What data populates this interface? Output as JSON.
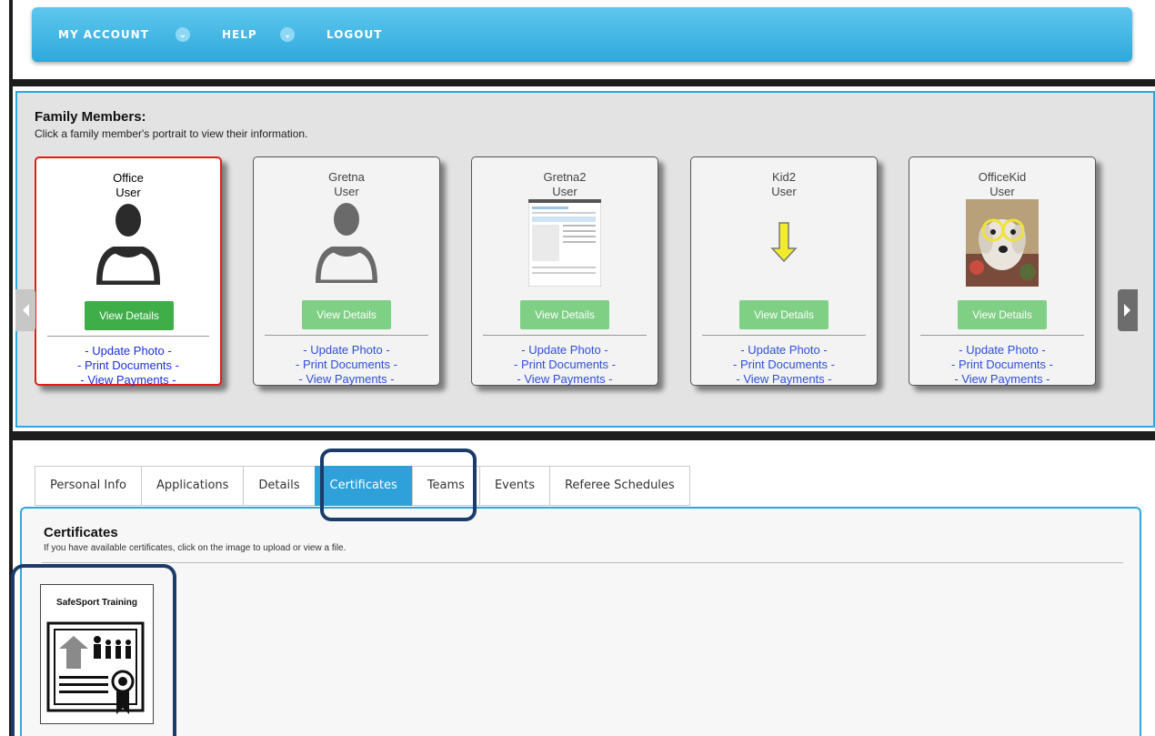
{
  "topnav": {
    "items": [
      {
        "label": "MY ACCOUNT",
        "has_dropdown": true
      },
      {
        "label": "HELP",
        "has_dropdown": true
      },
      {
        "label": "LOGOUT",
        "has_dropdown": false
      }
    ],
    "dropdown_glyph": "⌄"
  },
  "family": {
    "title": "Family Members:",
    "subtitle": "Click a family member's portrait to view their information.",
    "members": [
      {
        "first": "Office",
        "last": "User",
        "photo": "silhouette-icon",
        "active": true
      },
      {
        "first": "Gretna",
        "last": "User",
        "photo": "silhouette-outline-icon",
        "active": false
      },
      {
        "first": "Gretna2",
        "last": "User",
        "photo": "screenshot-thumbnail",
        "active": false
      },
      {
        "first": "Kid2",
        "last": "User",
        "photo": "down-arrow-icon",
        "active": false
      },
      {
        "first": "OfficeKid",
        "last": "User",
        "photo": "dog-photo",
        "active": false
      }
    ],
    "view_details": "View Details",
    "link_update_photo": "- Update Photo -",
    "link_print_documents": "- Print Documents -",
    "link_view_payments": "- View Payments -"
  },
  "tabs": [
    {
      "label": "Personal Info",
      "active": false
    },
    {
      "label": "Applications",
      "active": false
    },
    {
      "label": "Details",
      "active": false
    },
    {
      "label": "Certificates",
      "active": true
    },
    {
      "label": "Teams",
      "active": false
    },
    {
      "label": "Events",
      "active": false
    },
    {
      "label": "Referee Schedules",
      "active": false
    }
  ],
  "certificates": {
    "title": "Certificates",
    "subtitle": "If you have available certificates, click on the image to upload or view a file.",
    "items": [
      {
        "label": "SafeSport Training",
        "icon": "certificate-upload-icon"
      }
    ]
  },
  "colors": {
    "nav_blue": "#2fa9dc",
    "active_border": "#e41b1b",
    "button_green": "#3fae49",
    "link_blue": "#1c2fdc",
    "highlight_ring": "#1b3c6a"
  }
}
